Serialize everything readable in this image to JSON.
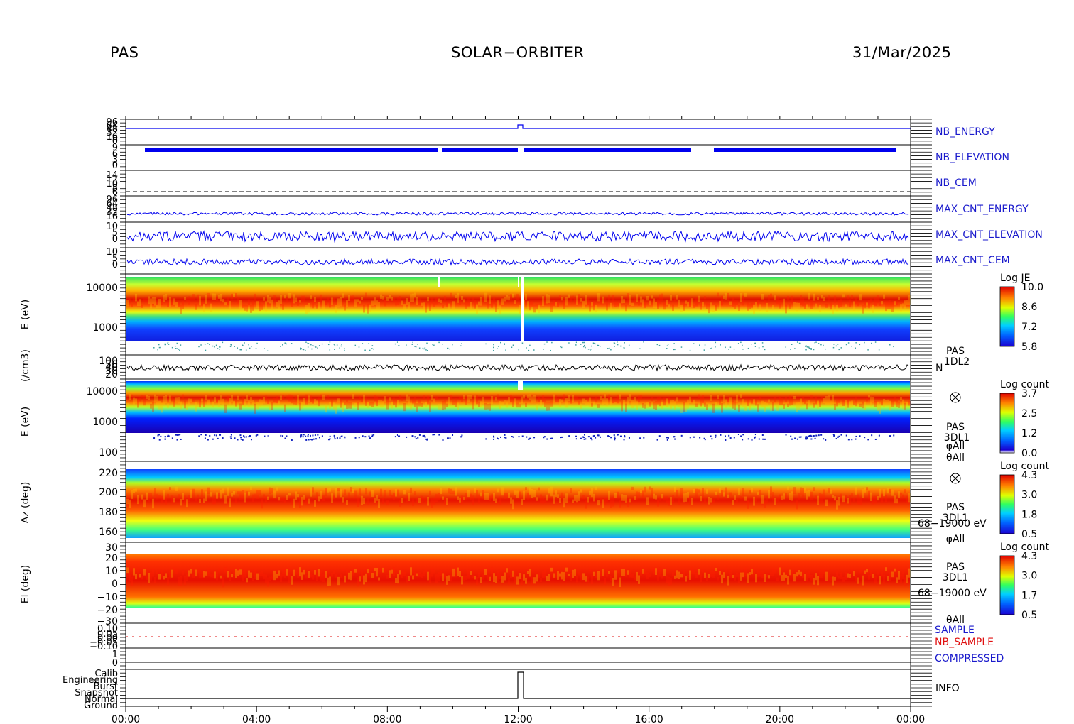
{
  "header": {
    "left": "PAS",
    "center": "SOLAR−ORBITER",
    "right": "31/Mar/2025"
  },
  "colors": {
    "blue_label": "#1a1acc",
    "red_label": "#e01010",
    "trace_blue": "#0000ee",
    "trace_black": "#000000"
  },
  "x_axis": {
    "ticks": [
      "00:00",
      "04:00",
      "08:00",
      "12:00",
      "16:00",
      "20:00",
      "00:00"
    ]
  },
  "chart_data": [
    {
      "type": "line",
      "label": "NB_ENERGY",
      "yticks": [
        "96",
        "64",
        "48",
        "32",
        "16",
        "0"
      ],
      "series": [
        {
          "values": [
            0,
            0,
            0,
            0,
            0,
            0,
            1,
            0,
            0,
            0,
            0,
            0,
            0
          ]
        }
      ]
    },
    {
      "type": "line",
      "label": "NB_ELEVATION",
      "yticks": [
        "9",
        "6",
        "3",
        "0"
      ],
      "series": [
        {
          "values": [
            7,
            7,
            7,
            7,
            7,
            7,
            7,
            7,
            7,
            7,
            7,
            7,
            7
          ]
        }
      ]
    },
    {
      "type": "line",
      "label": "NB_CEM",
      "yticks": [
        "14",
        "12",
        "10",
        "8",
        "6"
      ],
      "series": []
    },
    {
      "type": "line",
      "label": "MAX_CNT_ENERGY",
      "yticks": [
        "96",
        "64",
        "48",
        "32",
        "16"
      ],
      "series": []
    },
    {
      "type": "line",
      "label": "MAX_CNT_ELEVATION",
      "yticks": [
        "10",
        "5",
        "0"
      ],
      "series": []
    },
    {
      "type": "line",
      "label": "MAX_CNT_CEM",
      "yticks": [
        "10",
        "5",
        "0"
      ],
      "series": []
    },
    {
      "type": "heatmap",
      "ylabel": "E (eV)",
      "yticks": [
        "10000",
        "1000"
      ],
      "ylog": true,
      "colorbar": {
        "title": "Log JE",
        "ticks": [
          "10.0",
          "8.6",
          "7.2",
          "5.8"
        ]
      }
    },
    {
      "type": "line",
      "ylabel": "(/cm3)",
      "yticks": [
        "100",
        "50",
        "40",
        "30",
        "20"
      ],
      "labels": [
        "PAS",
        "1DL2",
        "N"
      ]
    },
    {
      "type": "heatmap",
      "ylabel": "E (eV)",
      "yticks": [
        "10000",
        "1000",
        "100"
      ],
      "ylog": true,
      "labels": [
        "PAS",
        "3DL1",
        "φAll",
        "θAll"
      ],
      "colorbar": {
        "title": "Log count",
        "ticks": [
          "3.7",
          "2.5",
          "1.2",
          "0.0"
        ]
      }
    },
    {
      "type": "heatmap",
      "ylabel": "Az (deg)",
      "yticks": [
        "220",
        "200",
        "180",
        "160"
      ],
      "labels": [
        "PAS",
        "3DL1",
        "68−19000 eV",
        "φAll"
      ],
      "colorbar": {
        "title": "Log count",
        "ticks": [
          "4.3",
          "3.0",
          "1.8",
          "0.5"
        ]
      }
    },
    {
      "type": "heatmap",
      "ylabel": "El (deg)",
      "yticks": [
        "30",
        "20",
        "10",
        "0",
        "−10",
        "−20",
        "−30"
      ],
      "labels": [
        "PAS",
        "3DL1",
        "68−19000 eV",
        "θAll"
      ],
      "colorbar": {
        "title": "Log count",
        "ticks": [
          "4.3",
          "3.0",
          "1.7",
          "0.5"
        ]
      }
    },
    {
      "type": "line",
      "yticks": [
        "0.10",
        "0.05",
        "0.00",
        "−0.05",
        "−0.10"
      ],
      "labels": [
        "SAMPLE",
        "NB_SAMPLE"
      ]
    },
    {
      "type": "line",
      "yticks": [
        "1",
        "0"
      ],
      "label": "COMPRESSED"
    },
    {
      "type": "line",
      "yticks": [
        "Calib",
        "Engineering",
        "Burst",
        "Snapshot",
        "Normal",
        "Ground"
      ],
      "label": "INFO"
    }
  ]
}
